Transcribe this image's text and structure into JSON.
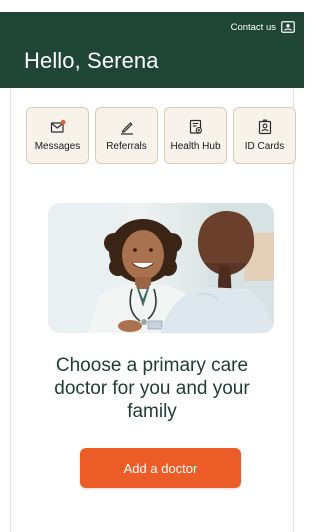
{
  "header": {
    "contact_label": "Contact us",
    "greeting": "Hello, Serena",
    "background": "#1f4536"
  },
  "quick_actions": [
    {
      "label": "Messages",
      "icon": "envelope-notification-icon"
    },
    {
      "label": "Referrals",
      "icon": "pen-icon"
    },
    {
      "label": "Health Hub",
      "icon": "health-document-icon"
    },
    {
      "label": "ID Cards",
      "icon": "id-badge-icon"
    }
  ],
  "hero": {
    "image": "doctor-with-patient-photo"
  },
  "promo": {
    "headline": "Choose a primary care doctor for you and your family",
    "cta_label": "Add a doctor",
    "cta_color": "#ec5c27"
  },
  "colors": {
    "notification_dot": "#ec5c27",
    "tile_background": "#f8f3ea",
    "tile_border": "#d9cdb9",
    "headline_text": "#1f3d33"
  }
}
